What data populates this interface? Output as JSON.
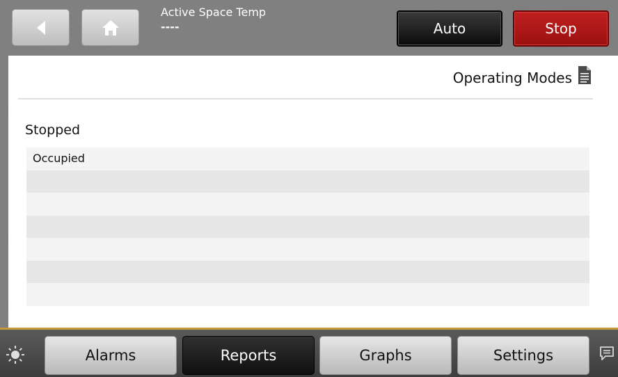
{
  "header": {
    "title_label": "Active Space Temp",
    "title_value": "----",
    "auto_label": "Auto",
    "stop_label": "Stop",
    "icons": {
      "back": "chevron-left-icon",
      "home": "home-icon"
    }
  },
  "content": {
    "page_title": "Operating Modes",
    "page_icon": "document-icon",
    "section_title": "Stopped",
    "rows": [
      "Occupied",
      "",
      "",
      "",
      "",
      "",
      ""
    ]
  },
  "footer": {
    "tabs": [
      {
        "label": "Alarms",
        "active": false
      },
      {
        "label": "Reports",
        "active": true
      },
      {
        "label": "Graphs",
        "active": false
      },
      {
        "label": "Settings",
        "active": false
      }
    ],
    "icons": {
      "left": "brightness-icon",
      "right": "chat-icon"
    }
  },
  "colors": {
    "stop_button": "#b01818",
    "auto_button": "#1a1a1a",
    "accent_line": "#c49a3c"
  }
}
